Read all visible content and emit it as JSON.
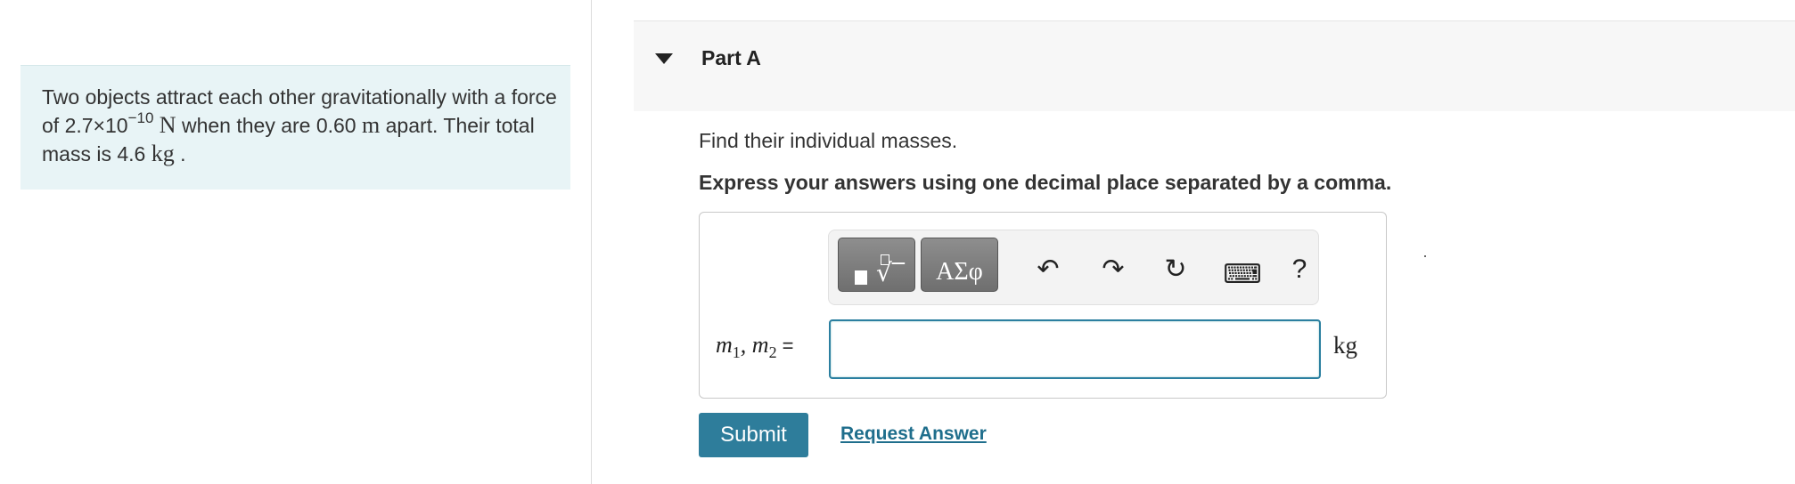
{
  "problem": {
    "text_part1": "Two objects attract each other gravitationally with a force of 2.7×10",
    "exponent": "−10",
    "unit_n": "N",
    "text_part2": " when they are 0.60 ",
    "unit_m": "m",
    "text_part3": " apart. Their total mass is 4.6 ",
    "unit_kg": "kg",
    "text_part4": " ."
  },
  "part": {
    "title": "Part A"
  },
  "instruction": "Find their individual masses.",
  "instruction_bold": "Express your answers using one decimal place separated by a comma.",
  "toolbar": {
    "symbols_label": "ΑΣφ",
    "undo_glyph": "↶",
    "redo_glyph": "↷",
    "reset_glyph": "↻",
    "keyboard_glyph": "⌨",
    "help_label": "?"
  },
  "answer": {
    "label_m1": "m",
    "sub1": "1",
    "separator": ", ",
    "label_m2": "m",
    "sub2": "2",
    "equals": "=",
    "value": "",
    "unit": "kg"
  },
  "actions": {
    "submit_label": "Submit",
    "request_answer_label": "Request Answer"
  },
  "colors": {
    "accent": "#2e7d9b",
    "problem_bg": "#e8f4f6",
    "link": "#1f6e8c"
  }
}
